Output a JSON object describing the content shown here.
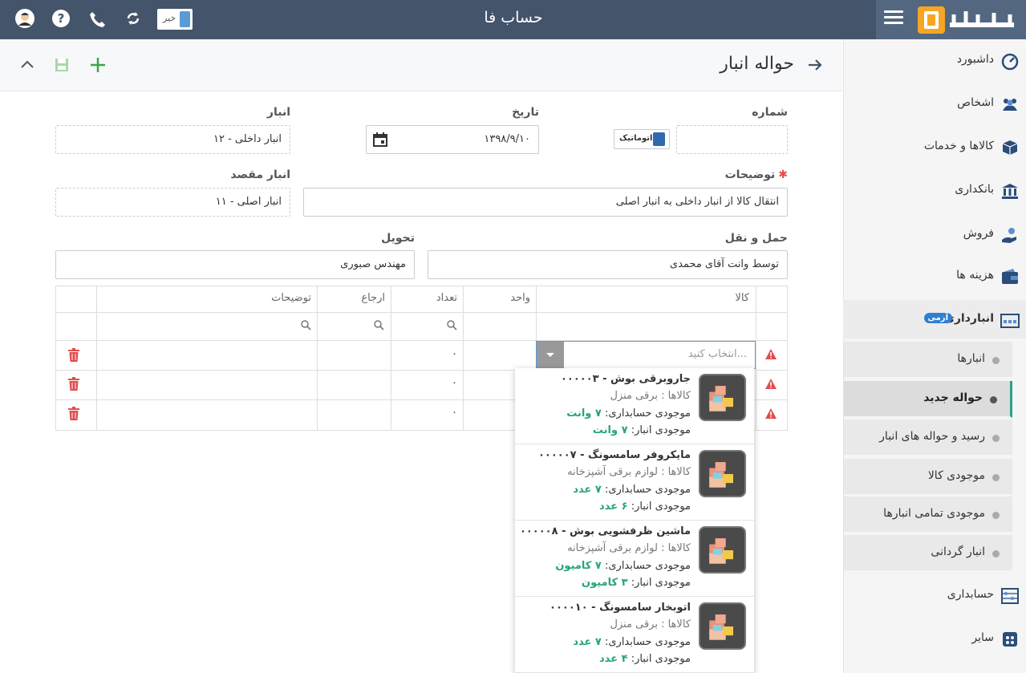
{
  "app": {
    "title": "حساب فا",
    "logo_text": "حساب فا",
    "lang_flag": "خیر"
  },
  "sidebar": {
    "items": [
      {
        "label": "داشبورد"
      },
      {
        "label": "اشخاص"
      },
      {
        "label": "کالاها و خدمات"
      },
      {
        "label": "بانکداری"
      },
      {
        "label": "فروش"
      },
      {
        "label": "هزینه ها"
      },
      {
        "label": "انبارداری"
      },
      {
        "label": "حسابداری"
      },
      {
        "label": "سایر"
      }
    ],
    "badge": "آزمی",
    "subitems": [
      {
        "label": "انبارها"
      },
      {
        "label": "حواله جدید"
      },
      {
        "label": "رسید و حواله های انبار"
      },
      {
        "label": "موجودی کالا"
      },
      {
        "label": "موجودی تمامی انبارها"
      },
      {
        "label": "انبار گردانی"
      }
    ]
  },
  "page": {
    "title": "حواله انبار"
  },
  "form": {
    "number_label": "شماره",
    "number_value": "",
    "auto_label": "اتوماتیک",
    "date_label": "تاریخ",
    "date_value": "۱۳۹۸/۹/۱۰",
    "warehouse_label": "انبار",
    "warehouse_value": "۱۲ - انبار داخلی",
    "desc_label": "توضیحات",
    "desc_value": "انتقال کالا از انبار داخلی به انبار اصلی",
    "dest_label": "انبار مقصد",
    "dest_value": "۱۱ - انبار اصلی",
    "transport_label": "حمل و نقل",
    "transport_value": "توسط وانت آقای محمدی",
    "delivery_label": "تحویل",
    "delivery_value": "مهندس صبوری"
  },
  "grid": {
    "columns": {
      "item": "کالا",
      "unit": "واحد",
      "qty": "تعداد",
      "ref": "ارجاع",
      "desc": "توضیحات"
    },
    "rows": [
      {
        "qty": "۰"
      },
      {
        "qty": "۰"
      },
      {
        "qty": "۰"
      }
    ],
    "select_placeholder": "انتخاب کنید..."
  },
  "dropdown": {
    "options": [
      {
        "code": "۰۰۰۰۰۳",
        "name": "جاروبرقی بوش",
        "category": "کالاها : برقی منزل",
        "acc_label": "موجودی حسابداری:",
        "acc_value": "۷ وانت",
        "wh_label": "موجودی انبار:",
        "wh_value": "۷ وانت"
      },
      {
        "code": "۰۰۰۰۰۷",
        "name": "مایکروفر سامسونگ",
        "category": "کالاها : لوازم برقی آشپزخانه",
        "acc_label": "موجودی حسابداری:",
        "acc_value": "۷ عدد",
        "wh_label": "موجودی انبار:",
        "wh_value": "۶ عدد"
      },
      {
        "code": "۰۰۰۰۰۸",
        "name": "ماشین ظرفشویی بوش",
        "category": "کالاها : لوازم برقی آشپزخانه",
        "acc_label": "موجودی حسابداری:",
        "acc_value": "۷ کامیون",
        "wh_label": "موجودی انبار:",
        "wh_value": "۳ کامیون"
      },
      {
        "code": "۰۰۰۰۱۰",
        "name": "اتوبخار سامسونگ",
        "category": "کالاها : برقی منزل",
        "acc_label": "موجودی حسابداری:",
        "acc_value": "۷ عدد",
        "wh_label": "موجودی انبار:",
        "wh_value": "۴ عدد"
      }
    ]
  }
}
